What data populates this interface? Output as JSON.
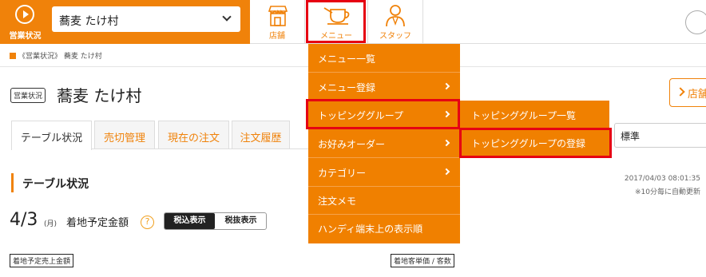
{
  "topbar": {
    "status_label": "営業状況",
    "store_select": "蕎麦 たけ村",
    "tabs": [
      {
        "label": "店舗",
        "icon": "store-icon"
      },
      {
        "label": "メニュー",
        "icon": "coffee-cup-icon"
      },
      {
        "label": "スタッフ",
        "icon": "staff-icon"
      }
    ]
  },
  "breadcrumb": "《営業状況》 蕎麦 たけ村",
  "page": {
    "badge": "営業状況",
    "title": "蕎麦 たけ村",
    "store_button": "店舗"
  },
  "content_tabs": [
    "テーブル状況",
    "売切管理",
    "現在の注文",
    "注文履歴"
  ],
  "sort_select": "標準",
  "section": {
    "title": "テーブル状況",
    "updated": "2017/04/03 08:01:35",
    "note": "※10分毎に自動更新"
  },
  "summary": {
    "date": "4/3",
    "dow": "(月)",
    "label": "着地予定金額",
    "help": "?",
    "tax_in": "税込表示",
    "tax_ex": "税抜表示",
    "tag_sales": "着地予定売上金額",
    "tag_customer": "着地客単価 / 客数"
  },
  "menu": {
    "items": [
      {
        "label": "メニュー一覧",
        "has_sub": false
      },
      {
        "label": "メニュー登録",
        "has_sub": true
      },
      {
        "label": "トッピンググループ",
        "has_sub": true
      },
      {
        "label": "お好みオーダー",
        "has_sub": true
      },
      {
        "label": "カテゴリー",
        "has_sub": true
      },
      {
        "label": "注文メモ",
        "has_sub": false
      },
      {
        "label": "ハンディ端末上の表示順",
        "has_sub": false
      }
    ],
    "submenu": [
      "トッピンググループ一覧",
      "トッピンググループの登録"
    ]
  },
  "colors": {
    "accent": "#f0820a",
    "highlight": "#e60012"
  }
}
